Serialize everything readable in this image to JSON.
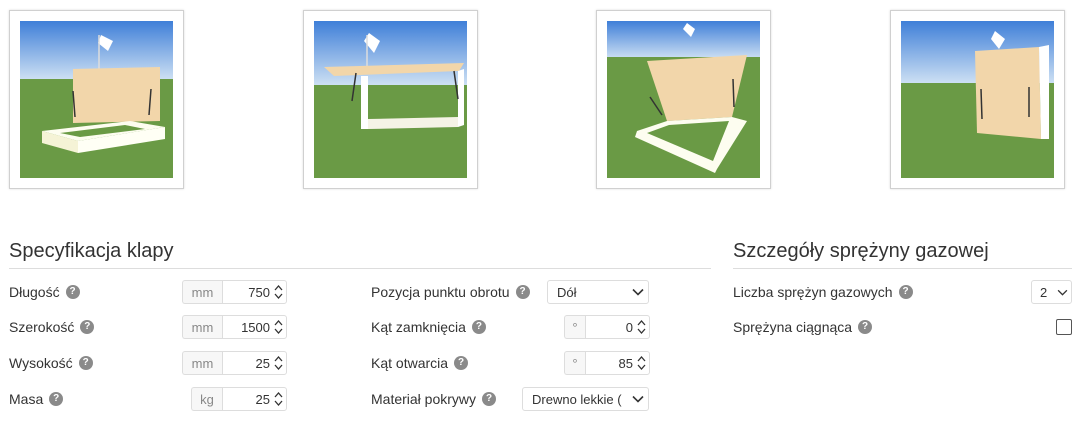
{
  "thumbnails": [
    {
      "name": "variant-1"
    },
    {
      "name": "variant-2"
    },
    {
      "name": "variant-3"
    },
    {
      "name": "variant-4"
    }
  ],
  "flap_spec": {
    "title": "Specyfikacja klapy",
    "length": {
      "label": "Długość",
      "unit": "mm",
      "value": "750"
    },
    "width": {
      "label": "Szerokość",
      "unit": "mm",
      "value": "1500"
    },
    "height": {
      "label": "Wysokość",
      "unit": "mm",
      "value": "25"
    },
    "mass": {
      "label": "Masa",
      "unit": "kg",
      "value": "25"
    },
    "pivot": {
      "label": "Pozycja punktu obrotu",
      "value": "Dół"
    },
    "closed_angle": {
      "label": "Kąt zamknięcia",
      "unit": "°",
      "value": "0"
    },
    "open_angle": {
      "label": "Kąt otwarcia",
      "unit": "°",
      "value": "85"
    },
    "material": {
      "label": "Materiał pokrywy",
      "value": "Drewno lekkie ("
    }
  },
  "spring": {
    "title": "Szczegóły sprężyny gazowej",
    "count": {
      "label": "Liczba sprężyn gazowych",
      "value": "2"
    },
    "tension": {
      "label": "Sprężyna ciągnąca",
      "checked": false
    }
  },
  "help_glyph": "?",
  "colors": {
    "sky_top": "#3f7fd8",
    "sky_bottom": "#d6e6f5",
    "grass": "#6a9a45",
    "wood": "#f2d6aa",
    "help": "#8a8a8a"
  }
}
